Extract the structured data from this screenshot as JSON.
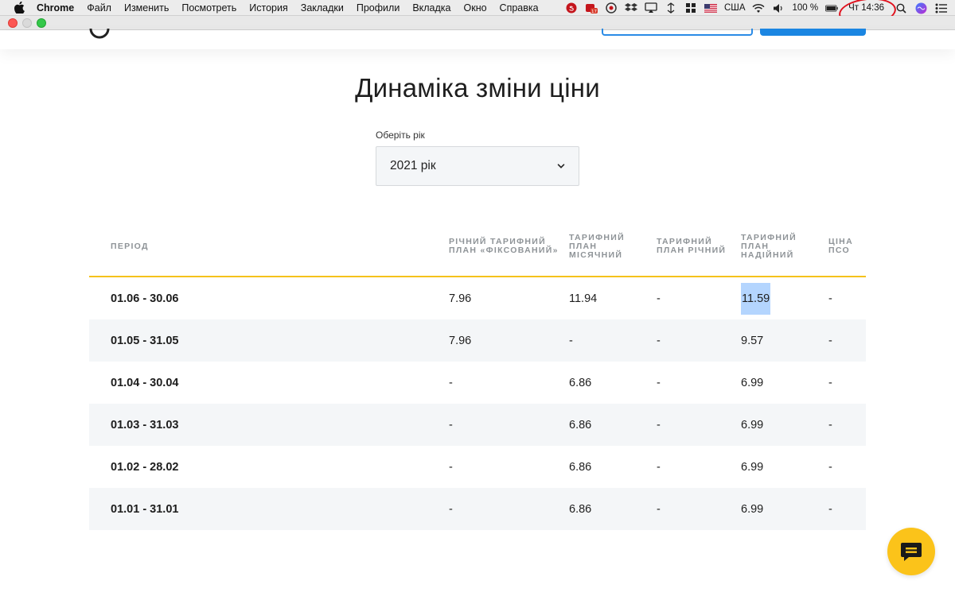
{
  "menubar": {
    "app_name": "Chrome",
    "items": [
      "Файл",
      "Изменить",
      "Посмотреть",
      "История",
      "Закладки",
      "Профили",
      "Вкладка",
      "Окно",
      "Справка"
    ],
    "status": {
      "keyboard_layout": "США",
      "battery": "100 %",
      "clock": "Чт 14:36",
      "badge_count": "17"
    }
  },
  "page": {
    "title": "Динаміка зміни ціни",
    "year_select": {
      "label": "Оберіть рік",
      "value": "2021 рік"
    }
  },
  "table": {
    "headers": {
      "period": "ПЕРІОД",
      "annual_fixed": [
        "РІЧНИЙ ТАРИФНИЙ",
        "ПЛАН «ФІКСОВАНИЙ»"
      ],
      "monthly": [
        "ТАРИФНИЙ",
        "ПЛАН",
        "МІСЯЧНИЙ"
      ],
      "annual": [
        "ТАРИФНИЙ",
        "ПЛАН РІЧНИЙ"
      ],
      "reliable": [
        "ТАРИФНИЙ",
        "ПЛАН",
        "НАДІЙНИЙ"
      ],
      "pso": [
        "ЦІНА",
        "ПСО"
      ]
    },
    "rows": [
      {
        "period": "01.06 - 30.06",
        "annual_fixed": "7.96",
        "monthly": "11.94",
        "annual": "-",
        "reliable": "11.59",
        "pso": "-"
      },
      {
        "period": "01.05 - 31.05",
        "annual_fixed": "7.96",
        "monthly": "-",
        "annual": "-",
        "reliable": "9.57",
        "pso": "-"
      },
      {
        "period": "01.04 - 30.04",
        "annual_fixed": "-",
        "monthly": "6.86",
        "annual": "-",
        "reliable": "6.99",
        "pso": "-"
      },
      {
        "period": "01.03 - 31.03",
        "annual_fixed": "-",
        "monthly": "6.86",
        "annual": "-",
        "reliable": "6.99",
        "pso": "-"
      },
      {
        "period": "01.02 - 28.02",
        "annual_fixed": "-",
        "monthly": "6.86",
        "annual": "-",
        "reliable": "6.99",
        "pso": "-"
      },
      {
        "period": "01.01 - 31.01",
        "annual_fixed": "-",
        "monthly": "6.86",
        "annual": "-",
        "reliable": "6.99",
        "pso": "-"
      }
    ]
  },
  "icons": {
    "apple": "apple-icon",
    "chevron": "chevron-down-icon",
    "chat": "chat-icon",
    "wifi": "wifi-icon",
    "volume": "volume-icon",
    "search": "spotlight-search-icon",
    "siri": "siri-icon",
    "control": "control-center-icon"
  },
  "colors": {
    "accent_yellow": "#fbc31a",
    "brand_blue": "#1b86e2",
    "table_stripe": "#f4f6f8",
    "selection_highlight": "#b4d5fe",
    "annotation_red": "#e0131f"
  }
}
